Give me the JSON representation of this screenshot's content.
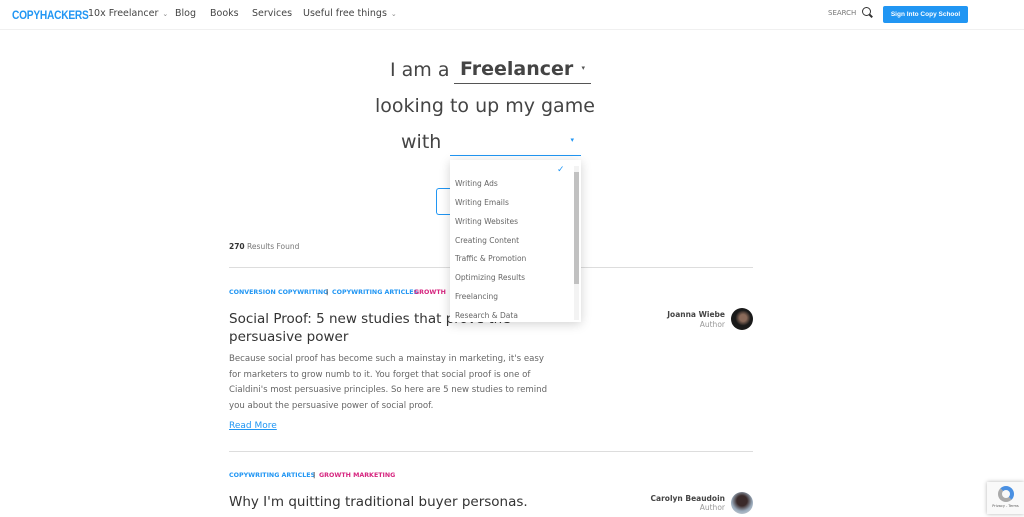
{
  "nav": {
    "logo": "COPYHACKERS",
    "items": [
      {
        "label": "10x Freelancer",
        "dropdown": true
      },
      {
        "label": "Blog"
      },
      {
        "label": "Books"
      },
      {
        "label": "Services"
      },
      {
        "label": "Useful free things",
        "dropdown": true
      }
    ],
    "search_label": "SEARCH",
    "cta": "Sign Into Copy School"
  },
  "hero": {
    "prefix": "I am a",
    "role": "Freelancer",
    "line2": "looking to up my game",
    "with": "with",
    "topic": ""
  },
  "dropdown": {
    "options": [
      "Writing Ads",
      "Writing Emails",
      "Writing Websites",
      "Creating Content",
      "Traffic & Promotion",
      "Optimizing Results",
      "Freelancing",
      "Research & Data"
    ]
  },
  "results": {
    "count": "270",
    "label": "Results Found"
  },
  "articles": [
    {
      "categories": [
        {
          "label": "CONVERSION COPYWRITING",
          "color": "#2196f3"
        },
        {
          "label": "COPYWRITING ARTICLES",
          "color": "#2196f3"
        },
        {
          "label": "GROWTH",
          "color": "#d6257f"
        }
      ],
      "title": "Social Proof: 5 new studies that prove the persuasive power",
      "excerpt": "Because social proof has become such a mainstay in marketing, it's easy for marketers to grow numb to it. You forget that social proof is one of Cialdini's most persuasive principles. So here are 5 new studies to remind you about the persuasive power of social proof.",
      "read_more": "Read More",
      "author": "Joanna Wiebe",
      "author_role": "Author"
    },
    {
      "categories": [
        {
          "label": "COPYWRITING ARTICLES",
          "color": "#2196f3"
        },
        {
          "label": "GROWTH MARKETING",
          "color": "#d6257f"
        }
      ],
      "title": "Why I'm quitting traditional buyer personas.",
      "author": "Carolyn Beaudoin",
      "author_role": "Author"
    }
  ],
  "recaptcha": {
    "text": "Privacy - Terms"
  }
}
